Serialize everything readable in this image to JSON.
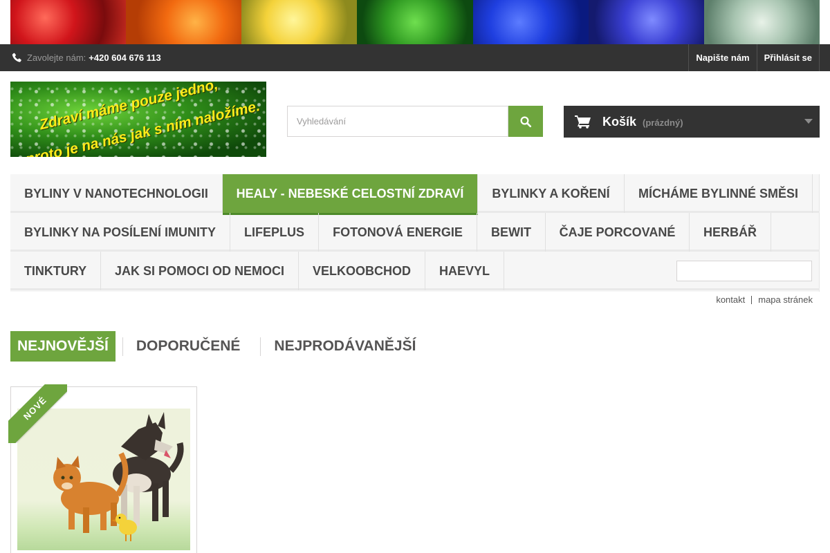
{
  "topbar": {
    "phone_label": "Zavolejte nám:",
    "phone_number": "+420 604 676 113",
    "links": [
      "Napište nám",
      "Přihlásit se"
    ]
  },
  "logo": {
    "line1": "Zdraví máme pouze jedno,",
    "line2": "proto je na nás jak s ním naložíme."
  },
  "search": {
    "placeholder": "Vyhledávání"
  },
  "cart": {
    "title": "Košík",
    "status": "(prázdný)"
  },
  "menu": {
    "row1": [
      "BYLINY V NANOTECHNOLOGII",
      "HEALY - NEBESKÉ CELOSTNÍ ZDRAVÍ",
      "BYLINKY A KOŘENÍ",
      "MÍCHÁME BYLINNÉ SMĚSI"
    ],
    "row2": [
      "BYLINKY NA POSÍLENÍ IMUNITY",
      "LIFEPLUS",
      "FOTONOVÁ ENERGIE",
      "BEWIT",
      "ČAJE PORCOVANÉ",
      "HERBÁŘ"
    ],
    "row3": [
      "TINKTURY",
      "JAK SI POMOCI OD NEMOCI",
      "VELKOOBCHOD",
      "HAEVYL"
    ],
    "active": "HEALY - NEBESKÉ CELOSTNÍ ZDRAVÍ"
  },
  "footer_links": [
    "kontakt",
    "mapa stránek"
  ],
  "tabs": [
    "NEJNOVĚJŠÍ",
    "DOPORUČENÉ",
    "NEJPRODÁVANĚJŠÍ"
  ],
  "product": {
    "badge": "NOVÉ"
  },
  "colors": {
    "accent": "#6ea53e",
    "dark": "#333333",
    "menu_bg": "#f6f6f6"
  }
}
